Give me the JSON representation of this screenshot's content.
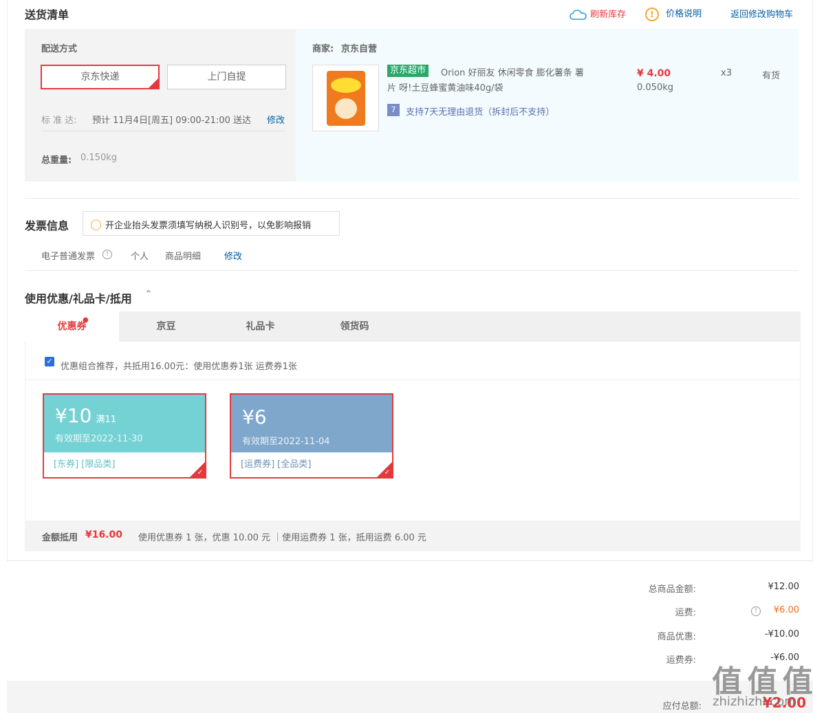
{
  "delivery": {
    "title": "送货清单",
    "refresh_stock": "刷新库存",
    "price_note": "价格说明",
    "back_to_cart": "返回修改购物车",
    "method_label": "配送方式",
    "option_jd_express": "京东快递",
    "option_pickup": "上门自提",
    "standard_label": "标 准 达:",
    "standard_text": "预计 11月4日[周五] 09:00-21:00 送达",
    "modify": "修改",
    "weight_label": "总重量:",
    "weight_value": "0.150kg",
    "merchant_label": "商家:",
    "merchant_name": "京东自营",
    "product": {
      "badge": "京东超市",
      "name": "Orion 好丽友 休闲零食 膨化薯条 薯片 呀!土豆蜂蜜黄油味40g/袋",
      "price": "¥ 4.00",
      "weight": "0.050kg",
      "qty": "x3",
      "stock": "有货",
      "return_badge": "7",
      "return_policy": "支持7天无理由退货（拆封后不支持）",
      "thumb_text": "呀!土豆"
    }
  },
  "invoice": {
    "title": "发票信息",
    "tip": "开企业抬头发票须填写纳税人识别号，以免影响报销",
    "type": "电子普通发票",
    "personal": "个人",
    "detail": "商品明细",
    "modify": "修改"
  },
  "discount": {
    "title": "使用优惠/礼品卡/抵用",
    "tabs": [
      "优惠券",
      "京豆",
      "礼品卡",
      "领货码"
    ],
    "recommend_text": "优惠组合推荐，共抵用16.00元：使用优惠券1张 运费券1张",
    "coupons": [
      {
        "amount": "¥10",
        "condition": "满11",
        "valid": "有效期至2022-11-30",
        "tags": "[东券]   [限品类]",
        "color": "#74d2d4",
        "tag_color": "#5cc0c2"
      },
      {
        "amount": "¥6",
        "condition": "",
        "valid": "有效期至2022-11-04",
        "tags": "[运费券]   [全品类]",
        "color": "#7fa7cc",
        "tag_color": "#6b8fb8"
      }
    ],
    "summary_label": "金额抵用",
    "summary_amount": "¥16.00",
    "summary_detail": "使用优惠券 1 张，优惠 10.00 元 ｜使用运费券 1 张，抵用运费 6.00 元"
  },
  "totals": {
    "goods_label": "总商品金额:",
    "goods_value": "¥12.00",
    "shipping_label": "运费:",
    "shipping_value": "¥6.00",
    "promo_label": "商品优惠:",
    "promo_value": "-¥10.00",
    "ship_coupon_label": "运费券:",
    "ship_coupon_value": "-¥6.00",
    "payable_label": "应付总额:",
    "payable_value": "¥2.00"
  },
  "watermark": "值 值 值",
  "watermark_sub": "zhizhizhi.com"
}
